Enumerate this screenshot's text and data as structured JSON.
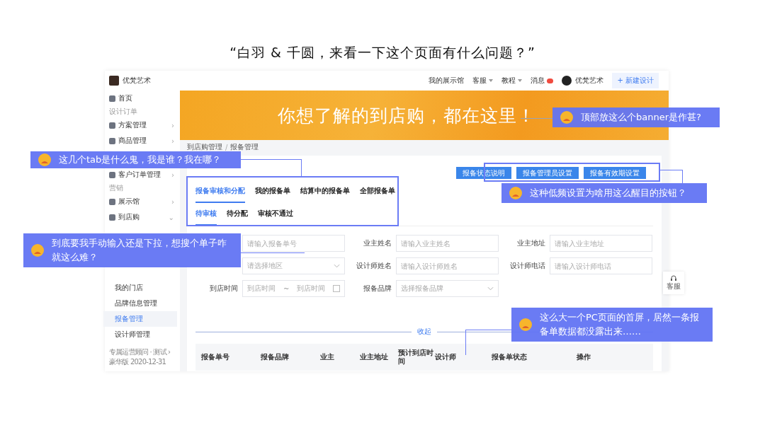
{
  "slide_title": "“白羽 & 千圆，来看一下这个页面有什么问题？”",
  "sidebar": {
    "brand": "优梵艺术",
    "items": [
      {
        "kind": "item",
        "label": "首页"
      },
      {
        "kind": "section",
        "label": "设计订单"
      },
      {
        "kind": "item",
        "label": "方案管理",
        "chevron": "›"
      },
      {
        "kind": "item",
        "label": "商品管理",
        "chevron": "›"
      },
      {
        "kind": "covered"
      },
      {
        "kind": "item",
        "label": "客户订单管理",
        "chevron": "›"
      },
      {
        "kind": "section",
        "label": "营销"
      },
      {
        "kind": "item",
        "label": "展示馆",
        "chevron": "›"
      },
      {
        "kind": "item",
        "label": "到店购",
        "chevron": "⌄"
      },
      {
        "kind": "covered"
      },
      {
        "kind": "covered"
      },
      {
        "kind": "covered"
      },
      {
        "kind": "sub",
        "label": "我的门店",
        "selected": false
      },
      {
        "kind": "sub",
        "label": "品牌信息管理",
        "selected": false
      },
      {
        "kind": "sub",
        "label": "报备管理",
        "selected": true
      },
      {
        "kind": "sub",
        "label": "设计师管理",
        "selected": false
      }
    ],
    "footer": [
      "专属运营顾问 · 测试 ›",
      "豪华版 2020-12-31"
    ]
  },
  "topbar": {
    "links": [
      {
        "label": "我的展示馆",
        "caret": false
      },
      {
        "label": "客服",
        "caret": true
      },
      {
        "label": "教程",
        "caret": true
      }
    ],
    "messages": "消息",
    "unread": true,
    "user": "优梵艺术",
    "new_button": "+ 新建设计"
  },
  "banner": {
    "text": "你想了解的到店购，都在这里！"
  },
  "breadcrumb": [
    "到店购管理",
    "报备管理"
  ],
  "breadcrumb_separator": "/",
  "settings_buttons": [
    "报备状态说明",
    "报备管理员设置",
    "报备有效期设置"
  ],
  "tabs": [
    {
      "label": "报备审核和分配",
      "selected": true
    },
    {
      "label": "我的报备单",
      "selected": false
    },
    {
      "label": "结算中的报备单",
      "selected": false
    },
    {
      "label": "全部报备单",
      "selected": false
    }
  ],
  "subtabs": [
    {
      "label": "待审核",
      "selected": true
    },
    {
      "label": "待分配",
      "selected": false
    },
    {
      "label": "审核不通过",
      "selected": false
    }
  ],
  "filters": [
    {
      "kind": "input",
      "placeholder": "请输入报备单号"
    },
    {
      "kind": "input",
      "label": "业主姓名",
      "placeholder": "请输入业主姓名"
    },
    {
      "kind": "input",
      "label": "业主地址",
      "placeholder": "请输入业主地址"
    },
    {
      "kind": "select",
      "placeholder": "请选择地区"
    },
    {
      "kind": "input",
      "label": "设计师姓名",
      "placeholder": "请输入设计师姓名"
    },
    {
      "kind": "input",
      "label": "设计师电话",
      "placeholder": "请输入设计师电话"
    },
    {
      "kind": "daterange",
      "label": "到店时间",
      "placeholder": "到店时间",
      "separator": "~",
      "placeholder_end": "到店时间"
    },
    {
      "kind": "select",
      "label": "报备品牌",
      "placeholder": "选择报备品牌"
    }
  ],
  "collapse": "收起",
  "table": {
    "columns": [
      "报备单号",
      "报备品牌",
      "业主",
      "业主地址",
      "预计到店时间",
      "设计师",
      "报备单状态",
      "操作"
    ]
  },
  "float_service": "客服",
  "annotations": [
    {
      "text": "顶部放这么个banner是作甚?"
    },
    {
      "text": "这几个tab是什么鬼，我是谁？我在哪？"
    },
    {
      "text": "这种低频设置为啥用这么醒目的按钮？"
    },
    {
      "text": "到底要我手动输入还是下拉，想搜个单子咋就这么难？"
    },
    {
      "text": "这么大一个PC页面的首屏，居然一条报备单数据都没露出来……"
    }
  ]
}
